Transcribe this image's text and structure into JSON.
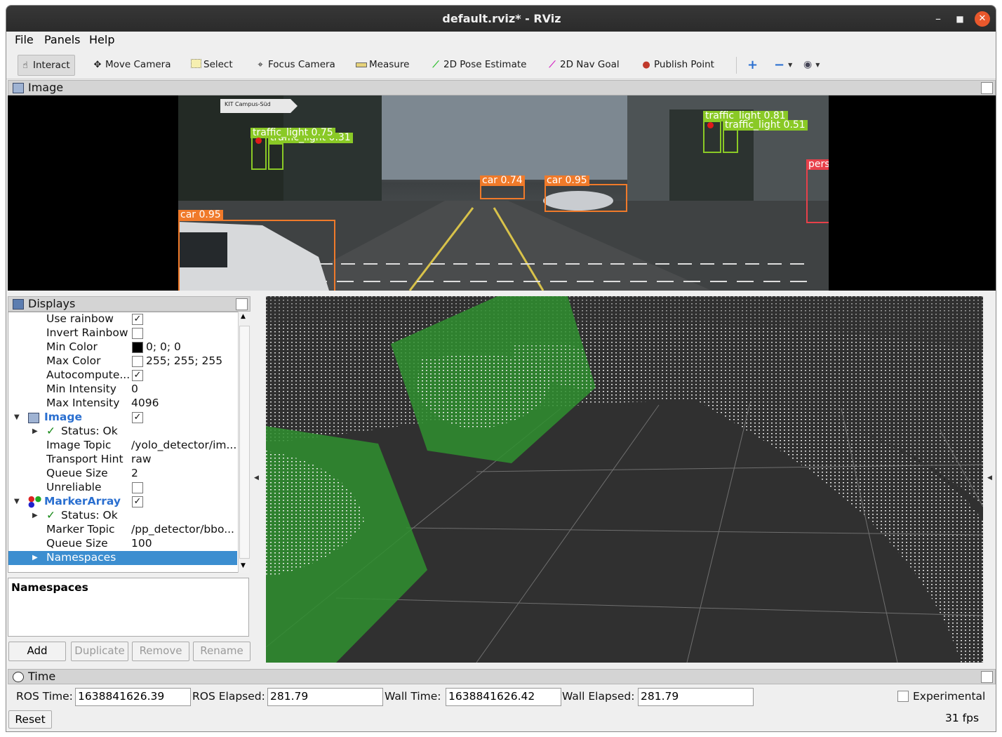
{
  "window": {
    "title": "default.rviz* - RViz"
  },
  "menu": [
    "File",
    "Panels",
    "Help"
  ],
  "toolbar": {
    "tools": [
      {
        "label": "Interact",
        "icon": "hand-pointer-icon"
      },
      {
        "label": "Move Camera",
        "icon": "move-arrows-icon"
      },
      {
        "label": "Select",
        "icon": "select-box-icon"
      },
      {
        "label": "Focus Camera",
        "icon": "crosshair-icon"
      },
      {
        "label": "Measure",
        "icon": "ruler-icon"
      },
      {
        "label": "2D Pose Estimate",
        "icon": "green-arrow-icon"
      },
      {
        "label": "2D Nav Goal",
        "icon": "magenta-arrow-icon"
      },
      {
        "label": "Publish Point",
        "icon": "map-pin-icon"
      }
    ]
  },
  "image_panel": {
    "title": "Image",
    "detections": [
      {
        "label": "traffic_light 0.75",
        "color": "#8ac926"
      },
      {
        "label": "traffic_light 0.31",
        "color": "#8ac926"
      },
      {
        "label": "traffic_light 0.81",
        "color": "#8ac926"
      },
      {
        "label": "traffic_light 0.51",
        "color": "#8ac926"
      },
      {
        "label": "car 0.95",
        "color": "#f07a2a"
      },
      {
        "label": "car 0.74",
        "color": "#f07a2a"
      },
      {
        "label": "car 0.95",
        "color": "#f07a2a"
      },
      {
        "label": "pers",
        "color": "#e8404a"
      }
    ],
    "sign_text": "KIT Campus-Süd"
  },
  "displays_panel": {
    "title": "Displays",
    "rows": [
      {
        "key": "Use rainbow",
        "checked": true
      },
      {
        "key": "Invert Rainbow",
        "checked": false
      },
      {
        "key": "Min Color",
        "value": "0; 0; 0",
        "swatch": "#000000"
      },
      {
        "key": "Max Color",
        "value": "255; 255; 255",
        "swatch": "#ffffff"
      },
      {
        "key": "Autocompute...",
        "checked": true
      },
      {
        "key": "Min Intensity",
        "value": "0"
      },
      {
        "key": "Max Intensity",
        "value": "4096"
      },
      {
        "key": "Image",
        "checked": true
      },
      {
        "key": "Status: Ok"
      },
      {
        "key": "Image Topic",
        "value": "/yolo_detector/im..."
      },
      {
        "key": "Transport Hint",
        "value": "raw"
      },
      {
        "key": "Queue Size",
        "value": "2"
      },
      {
        "key": "Unreliable",
        "checked": false
      },
      {
        "key": "MarkerArray",
        "checked": true
      },
      {
        "key": "Status: Ok"
      },
      {
        "key": "Marker Topic",
        "value": "/pp_detector/bbo..."
      },
      {
        "key": "Queue Size",
        "value": "100"
      },
      {
        "key": "Namespaces",
        "value": ""
      }
    ],
    "description_title": "Namespaces",
    "buttons": [
      "Add",
      "Duplicate",
      "Remove",
      "Rename"
    ]
  },
  "time_panel": {
    "title": "Time",
    "ros_time_label": "ROS Time:",
    "ros_time": "1638841626.39",
    "ros_elapsed_label": "ROS Elapsed:",
    "ros_elapsed": "281.79",
    "wall_time_label": "Wall Time:",
    "wall_time": "1638841626.42",
    "wall_elapsed_label": "Wall Elapsed:",
    "wall_elapsed": "281.79",
    "experimental_label": "Experimental",
    "reset_label": "Reset",
    "fps": "31 fps"
  }
}
